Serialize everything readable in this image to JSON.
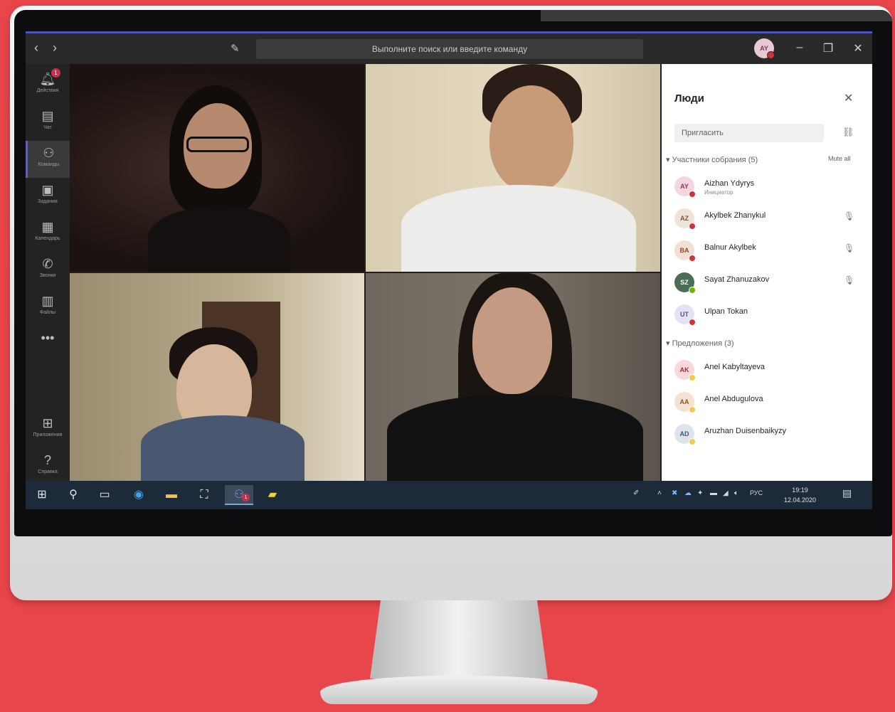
{
  "titlebar": {
    "search_placeholder": "Выполните поиск или введите команду",
    "user_initials": "AY"
  },
  "rail": [
    {
      "label": "Действия",
      "icon": "bell-icon",
      "badge": "1"
    },
    {
      "label": "Чат",
      "icon": "chat-icon"
    },
    {
      "label": "Команды",
      "icon": "teams-icon",
      "active": true
    },
    {
      "label": "Задания",
      "icon": "assignments-icon"
    },
    {
      "label": "Календарь",
      "icon": "calendar-icon"
    },
    {
      "label": "Звонки",
      "icon": "phone-icon"
    },
    {
      "label": "Файлы",
      "icon": "files-icon"
    },
    {
      "label": "•••",
      "icon": "more-icon"
    },
    {
      "label": "Приложения",
      "icon": "apps-icon"
    },
    {
      "label": "Справка",
      "icon": "help-icon"
    }
  ],
  "people_panel": {
    "title": "Люди",
    "invite_placeholder": "Пригласить",
    "participants_heading": "Участники собрания (5)",
    "mute_all": "Mute all",
    "participants": [
      {
        "initials": "AY",
        "name": "Aizhan Ydyrys",
        "role": "Инициатор",
        "status_color": "#d13438",
        "avatar_bg": "#f3d6e2",
        "avatar_fg": "#8a3b5a",
        "muted": false
      },
      {
        "initials": "AZ",
        "name": "Akylbek Zhanykul",
        "role": "",
        "status_color": "#d13438",
        "avatar_bg": "#efe3d8",
        "avatar_fg": "#7a5236",
        "muted": true
      },
      {
        "initials": "BA",
        "name": "Balnur Akylbek",
        "role": "",
        "status_color": "#d13438",
        "avatar_bg": "#f2e0d6",
        "avatar_fg": "#8a4a2c",
        "muted": true
      },
      {
        "initials": "SZ",
        "name": "Sayat Zhanuzakov",
        "role": "",
        "status_color": "#6bb700",
        "avatar_bg": "#4b6d57",
        "avatar_fg": "#ffffff",
        "muted": true
      },
      {
        "initials": "UT",
        "name": "Ulpan Tokan",
        "role": "",
        "status_color": "#d13438",
        "avatar_bg": "#e3e2f4",
        "avatar_fg": "#4f4d9b",
        "muted": false
      }
    ],
    "suggestions_heading": "Предложения (3)",
    "suggestions": [
      {
        "initials": "AK",
        "name": "Anel Kabyltayeva",
        "status_color": "#f2c94c",
        "avatar_bg": "#f6d9dc",
        "avatar_fg": "#9b2f3a"
      },
      {
        "initials": "AA",
        "name": "Anel Abdugulova",
        "status_color": "#f2c94c",
        "avatar_bg": "#f3e2d2",
        "avatar_fg": "#8a5526"
      },
      {
        "initials": "AD",
        "name": "Aruzhan Duisenbaikyzy",
        "status_color": "#f2c94c",
        "avatar_bg": "#dde4ea",
        "avatar_fg": "#3d5a73"
      }
    ]
  },
  "taskbar": {
    "language": "РУС",
    "time": "19:19",
    "date": "12.04.2020",
    "teams_badge": "1"
  }
}
